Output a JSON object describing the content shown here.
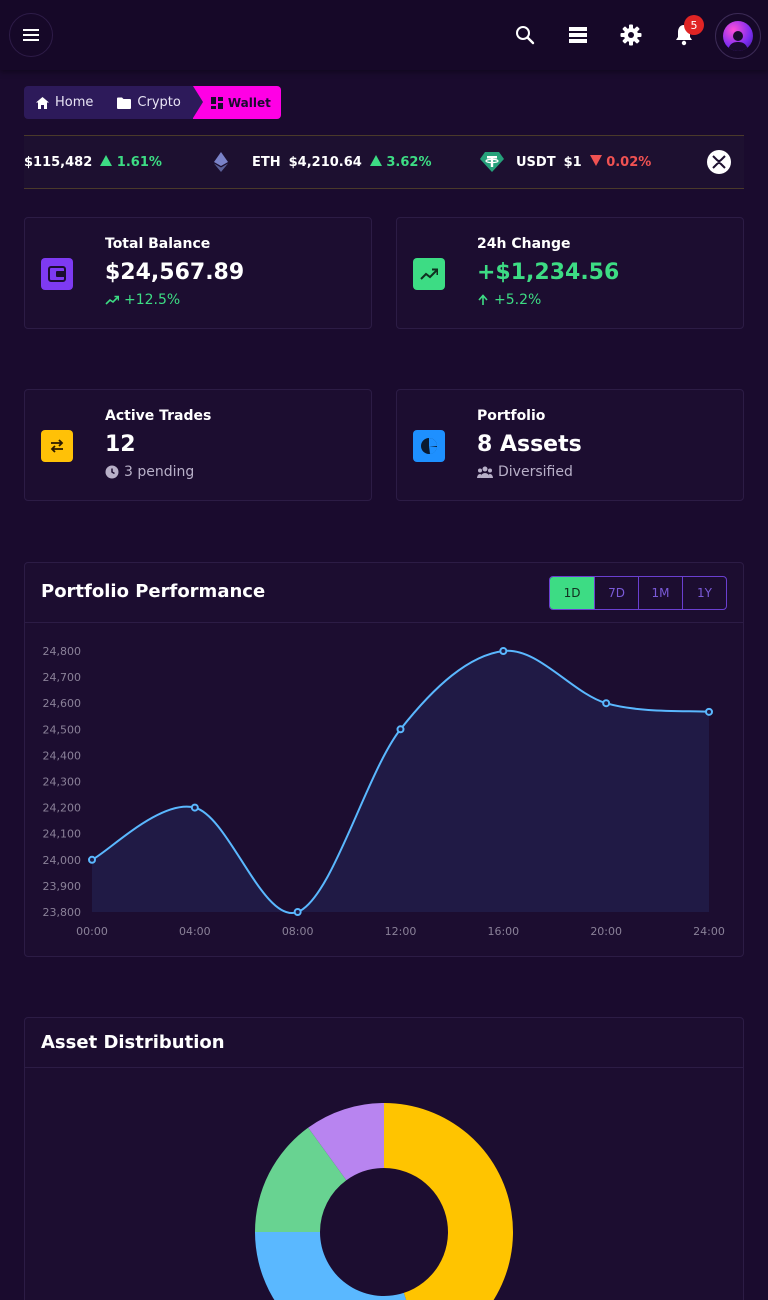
{
  "header": {
    "notification_count": "5",
    "icons": [
      "menu-icon",
      "search-icon",
      "layers-icon",
      "gear-icon",
      "bell-icon",
      "avatar"
    ]
  },
  "breadcrumb": {
    "home": "Home",
    "crypto": "Crypto",
    "wallet": "Wallet"
  },
  "ticker": [
    {
      "symbol": "",
      "price": "$115,482",
      "change": "1.61%",
      "direction": "up"
    },
    {
      "symbol": "ETH",
      "price": "$4,210.64",
      "change": "3.62%",
      "direction": "up"
    },
    {
      "symbol": "USDT",
      "price": "$1",
      "change": "0.02%",
      "direction": "down"
    }
  ],
  "stats": {
    "total_balance": {
      "title": "Total Balance",
      "value": "$24,567.89",
      "sub": "+12.5%",
      "color": "#7e3af2"
    },
    "change_24h": {
      "title": "24h Change",
      "value": "+$1,234.56",
      "sub": "+5.2%",
      "color": "#3ddc84"
    },
    "active_trades": {
      "title": "Active Trades",
      "value": "12",
      "sub": "3 pending",
      "color": "#ffc107"
    },
    "portfolio": {
      "title": "Portfolio",
      "value": "8 Assets",
      "sub": "Diversified",
      "color": "#1e90ff"
    }
  },
  "performance": {
    "title": "Portfolio Performance",
    "ranges": [
      "1D",
      "7D",
      "1M",
      "1Y"
    ],
    "active_range": "1D"
  },
  "distribution": {
    "title": "Asset Distribution"
  },
  "chart_data": [
    {
      "type": "area",
      "title": "",
      "x": [
        "00:00",
        "04:00",
        "08:00",
        "12:00",
        "16:00",
        "20:00",
        "24:00"
      ],
      "series": [
        {
          "values": [
            24000,
            24200,
            23800,
            24500,
            24800,
            24600,
            24567
          ]
        }
      ],
      "ylim": [
        23800,
        24800
      ],
      "yticks": [
        "23,800",
        "23,900",
        "24,000",
        "24,100",
        "24,200",
        "24,300",
        "24,400",
        "24,500",
        "24,600",
        "24,700",
        "24,800"
      ],
      "grid": false,
      "colors": {
        "line": "#5ab8ff",
        "fill": "#201a45"
      }
    },
    {
      "type": "pie",
      "title": "",
      "values": [
        45,
        30,
        15,
        10
      ],
      "colors": [
        "#ffc400",
        "#5ab8ff",
        "#68d391",
        "#b884f0"
      ]
    }
  ]
}
